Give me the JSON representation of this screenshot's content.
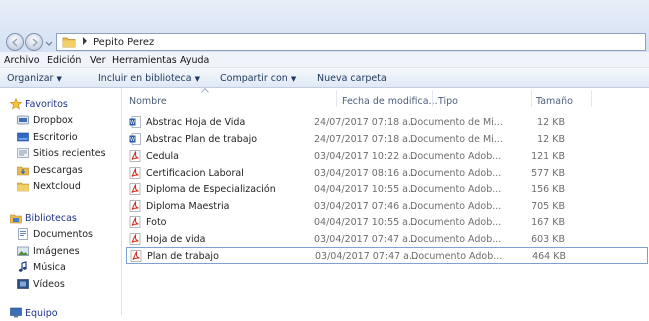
{
  "address": {
    "crumb": "Pepito Perez"
  },
  "menu": {
    "items": [
      "Archivo",
      "Edición",
      "Ver",
      "Herramientas",
      "Ayuda"
    ]
  },
  "commands": {
    "organize": "Organizar",
    "include": "Incluir en biblioteca",
    "share": "Compartir con",
    "new_folder": "Nueva carpeta"
  },
  "nav": {
    "favorites_label": "Favoritos",
    "favorites": [
      {
        "label": "Dropbox",
        "icon": "dropbox-icon"
      },
      {
        "label": "Escritorio",
        "icon": "desktop-icon"
      },
      {
        "label": "Sitios recientes",
        "icon": "recent-places-icon"
      },
      {
        "label": "Descargas",
        "icon": "downloads-icon"
      },
      {
        "label": "Nextcloud",
        "icon": "folder-icon"
      }
    ],
    "libraries_label": "Bibliotecas",
    "libraries": [
      {
        "label": "Documentos",
        "icon": "documents-icon"
      },
      {
        "label": "Imágenes",
        "icon": "pictures-icon"
      },
      {
        "label": "Música",
        "icon": "music-icon"
      },
      {
        "label": "Vídeos",
        "icon": "videos-icon"
      }
    ],
    "computer_label": "Equipo"
  },
  "columns": {
    "name": "Nombre",
    "date": "Fecha de modifica...",
    "type": "Tipo",
    "size": "Tamaño"
  },
  "files": [
    {
      "name": "Abstrac Hoja de Vida",
      "date": "24/07/2017 07:18 a...",
      "type": "Documento de Mi...",
      "size": "12 KB",
      "icon": "word-icon"
    },
    {
      "name": "Abstrac Plan de trabajo",
      "date": "24/07/2017 07:18 a...",
      "type": "Documento de Mi...",
      "size": "12 KB",
      "icon": "word-icon"
    },
    {
      "name": "Cedula",
      "date": "03/04/2017 10:22 a...",
      "type": "Documento Adob...",
      "size": "121 KB",
      "icon": "pdf-icon"
    },
    {
      "name": "Certificacion Laboral",
      "date": "03/04/2017 08:16 a...",
      "type": "Documento Adob...",
      "size": "577 KB",
      "icon": "pdf-icon"
    },
    {
      "name": "Diploma de Especialización",
      "date": "04/04/2017 10:55 a...",
      "type": "Documento Adob...",
      "size": "156 KB",
      "icon": "pdf-icon"
    },
    {
      "name": "Diploma Maestria",
      "date": "03/04/2017 07:46 a...",
      "type": "Documento Adob...",
      "size": "705 KB",
      "icon": "pdf-icon"
    },
    {
      "name": "Foto",
      "date": "04/04/2017 10:55 a...",
      "type": "Documento Adob...",
      "size": "167 KB",
      "icon": "pdf-icon"
    },
    {
      "name": "Hoja de vida",
      "date": "03/04/2017 07:47 a...",
      "type": "Documento Adob...",
      "size": "603 KB",
      "icon": "pdf-icon"
    },
    {
      "name": "Plan de trabajo",
      "date": "03/04/2017 07:47 a...",
      "type": "Documento Adob...",
      "size": "464 KB",
      "icon": "pdf-icon",
      "selected": true
    }
  ],
  "colors": {
    "nav_group": "#1e3287",
    "command_text": "#1e395b",
    "selection_border": "#7da2ce",
    "pdf_red": "#d42a1f",
    "word_blue": "#2a5aa8"
  }
}
